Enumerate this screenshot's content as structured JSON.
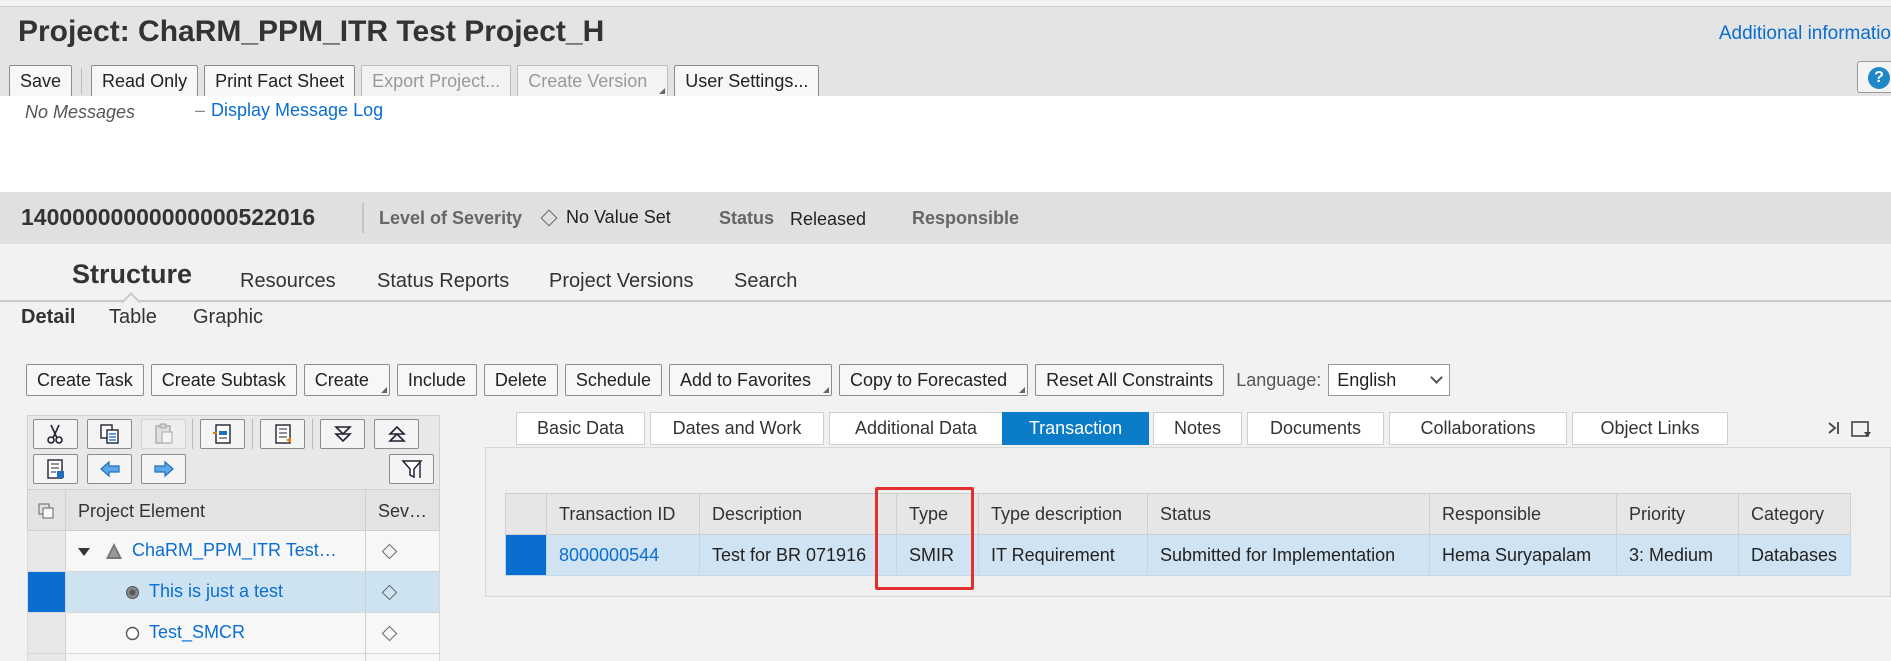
{
  "header": {
    "title": "Project: ChaRM_PPM_ITR Test Project_H",
    "additional_info": "Additional informatio",
    "help_icon": "?"
  },
  "toolbar": {
    "save": "Save",
    "read_only": "Read Only",
    "print_fact_sheet": "Print Fact Sheet",
    "export_project": "Export Project...",
    "create_version": "Create Version",
    "user_settings": "User Settings..."
  },
  "messages": {
    "status": "No Messages",
    "log_link": "Display Message Log"
  },
  "project_header": {
    "number": "14000000000000000522016",
    "severity_label": "Level of Severity",
    "severity_value": "No Value Set",
    "status_label": "Status",
    "status_value": "Released",
    "responsible_label": "Responsible"
  },
  "main_tabs": [
    "Structure",
    "Resources",
    "Status Reports",
    "Project Versions",
    "Search"
  ],
  "sub_tabs": [
    "Detail",
    "Table",
    "Graphic"
  ],
  "actions": {
    "create_task": "Create Task",
    "create_subtask": "Create Subtask",
    "create": "Create",
    "include": "Include",
    "delete": "Delete",
    "schedule": "Schedule",
    "add_to_favorites": "Add to Favorites",
    "copy_to_forecasted": "Copy to Forecasted",
    "reset_constraints": "Reset All Constraints",
    "language_label": "Language:",
    "language_value": "English"
  },
  "tree": {
    "col_element": "Project Element",
    "col_severity": "Sev…",
    "rows": [
      {
        "label": "ChaRM_PPM_ITR Test…"
      },
      {
        "label": "This is just a test"
      },
      {
        "label": "Test_SMCR"
      }
    ]
  },
  "detail_tabs": [
    "Basic Data",
    "Dates and Work",
    "Additional Data",
    "Transaction",
    "Notes",
    "Documents",
    "Collaborations",
    "Object Links"
  ],
  "transactions": {
    "columns": [
      "Transaction ID",
      "Description",
      "Type",
      "Type description",
      "Status",
      "Responsible",
      "Priority",
      "Category"
    ],
    "rows": [
      {
        "id": "8000000544",
        "description": "Test for BR 071916",
        "type": "SMIR",
        "type_description": "IT Requirement",
        "status": "Submitted for Implementation",
        "responsible": "Hema Suryapalam",
        "priority": "3: Medium",
        "category": "Databases"
      }
    ]
  },
  "colors": {
    "accent": "#0a6ed1",
    "active_tab": "#0a7cc8",
    "selected_row": "#cfe3f2",
    "highlight": "#e03030"
  }
}
